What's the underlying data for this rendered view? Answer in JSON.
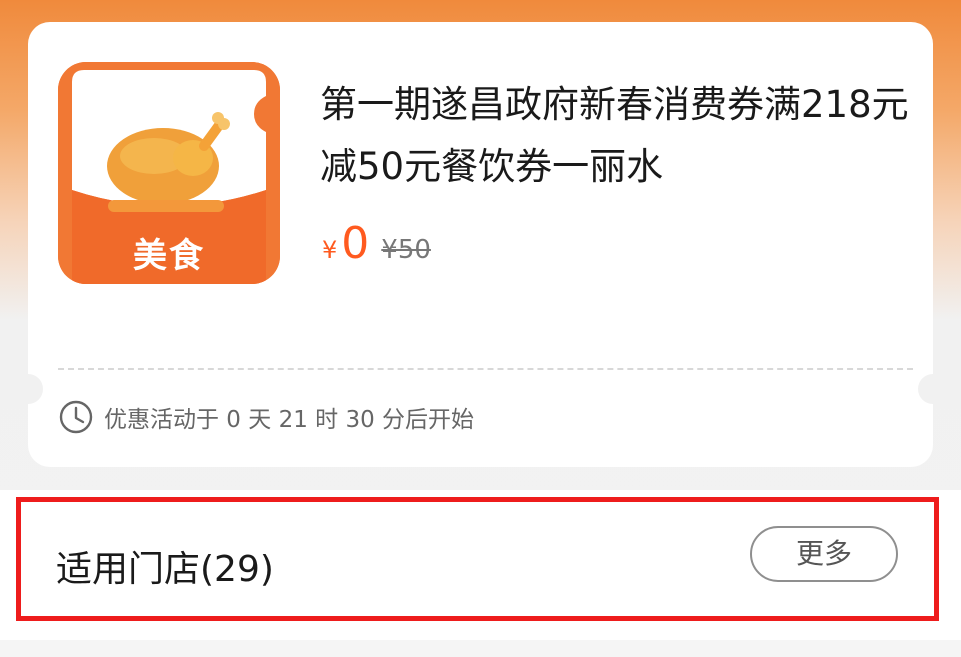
{
  "coupon": {
    "icon_label": "美食",
    "title": "第一期遂昌政府新春消费券满218元减50元餐饮券一丽水",
    "price": {
      "currency_symbol": "¥",
      "current": "0",
      "original": "¥50"
    },
    "countdown_text": "优惠活动于 0 天 21 时 30 分后开始"
  },
  "stores": {
    "title": "适用门店(29)",
    "more_label": "更多"
  },
  "colors": {
    "brand_orange": "#f17834",
    "price_red": "#ff5a1f",
    "highlight_red": "#ee1c1c"
  },
  "icons": {
    "food_icon": "roast-chicken-icon",
    "clock_icon": "clock-icon"
  }
}
